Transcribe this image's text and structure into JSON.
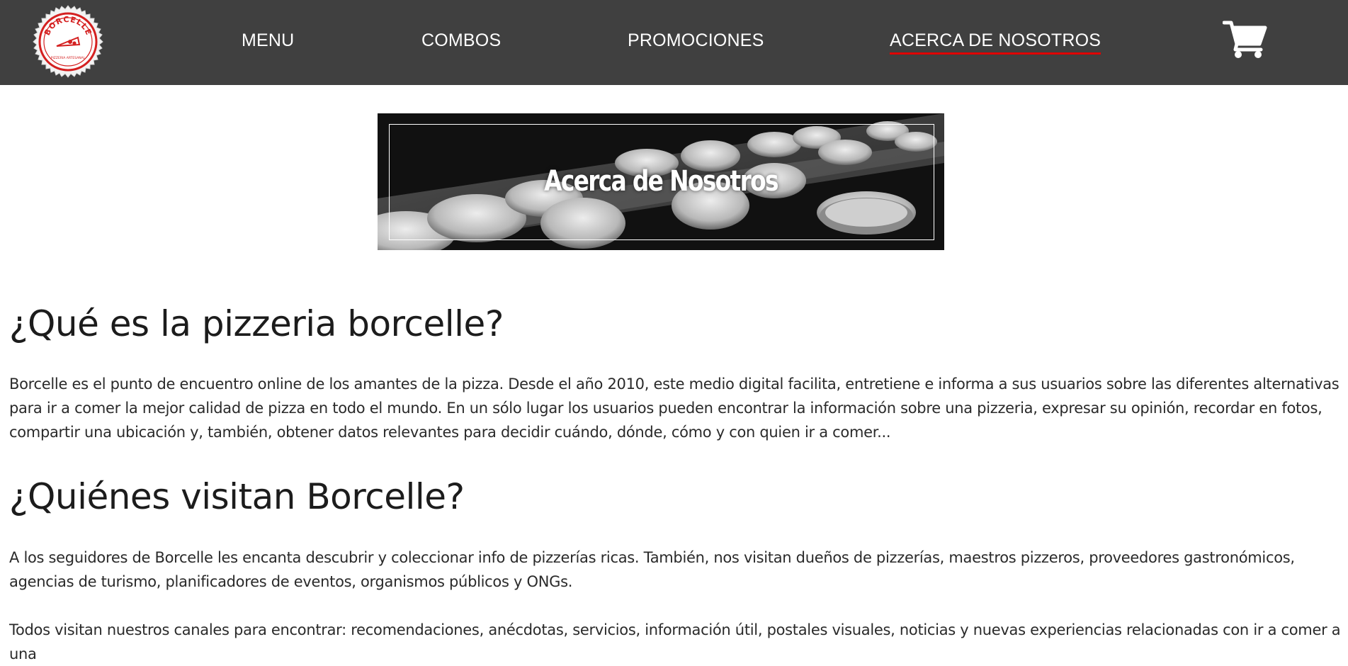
{
  "brand": {
    "logo_text": "BORCELLE",
    "logo_subtext": "PIZZERIA ARTESANAL",
    "accent_color": "#e00000",
    "navbar_color": "#404040"
  },
  "nav": {
    "items": [
      {
        "label": "MENU"
      },
      {
        "label": "COMBOS"
      },
      {
        "label": "PROMOCIONES"
      },
      {
        "label": "ACERCA DE NOSOTROS",
        "active": true
      }
    ],
    "cart_icon": "shopping-cart-icon"
  },
  "hero": {
    "title": "Acerca de Nosotros"
  },
  "sections": [
    {
      "heading": "¿Qué es la pizzeria borcelle?",
      "paragraph": "Borcelle es el punto de encuentro online de los amantes de la pizza. Desde el año 2010, este medio digital facilita, entretiene e informa a sus usuarios sobre las diferentes alternativas para ir a comer la mejor calidad de pizza en todo el mundo. En un sólo lugar los usuarios pueden encontrar la información sobre una pizzeria, expresar su opinión, recordar en fotos, compartir una ubicación y, también, obtener datos relevantes para decidir cuándo, dónde, cómo y con quien ir a comer..."
    },
    {
      "heading": "¿Quiénes visitan Borcelle?",
      "paragraph": "A los seguidores de Borcelle les encanta descubrir y coleccionar info de pizzerías ricas. También, nos visitan dueños de pizzerías, maestros pizzeros, proveedores gastronómicos, agencias de turismo, planificadores de eventos, organismos públicos y ONGs.",
      "paragraph2": "Todos visitan nuestros canales para encontrar: recomendaciones, anécdotas, servicios, información útil, postales visuales, noticias y nuevas experiencias relacionadas con ir a comer a una"
    }
  ]
}
